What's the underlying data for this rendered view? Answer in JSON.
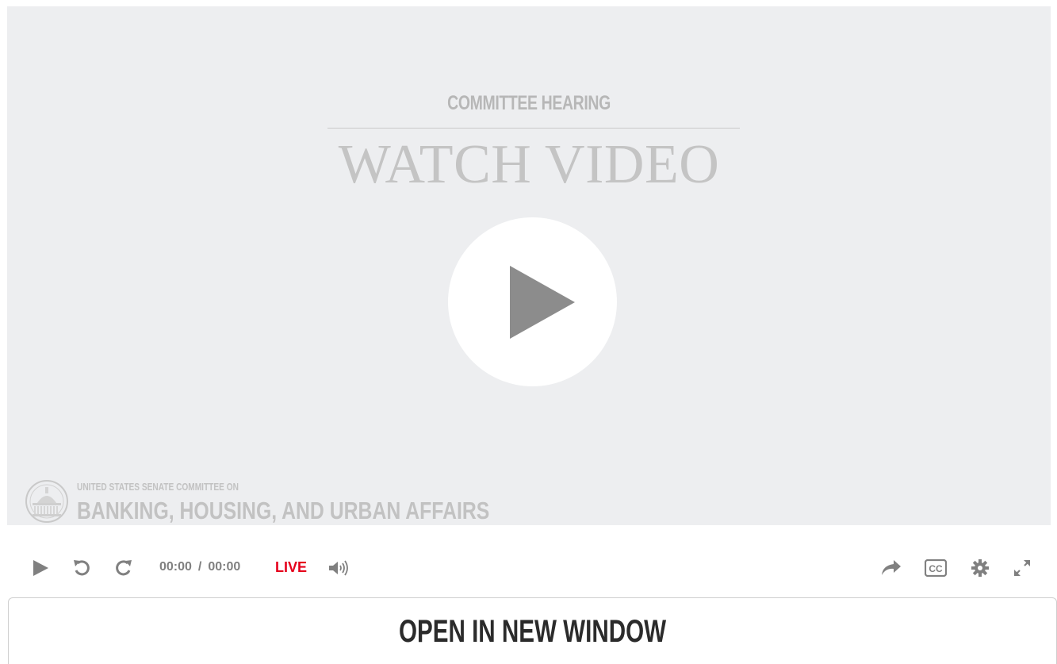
{
  "video": {
    "subtitle": "COMMITTEE HEARING",
    "title": "WATCH VIDEO",
    "org_line1": "UNITED STATES SENATE COMMITTEE ON",
    "org_line2": "BANKING, HOUSING, AND URBAN AFFAIRS"
  },
  "controls": {
    "current_time": "00:00",
    "separator": "/",
    "duration": "00:00",
    "live_label": "LIVE",
    "icons": [
      "play-icon",
      "rewind-icon",
      "forward-icon",
      "volume-icon",
      "share-icon",
      "closed-captions-icon",
      "settings-icon",
      "fullscreen-icon"
    ]
  },
  "open_window": {
    "label": "OPEN IN NEW WINDOW"
  },
  "colors": {
    "live": "#e5001c",
    "control_icon": "#808080",
    "video_bg": "#edeef0",
    "play_triangle": "#8c8c8c"
  }
}
